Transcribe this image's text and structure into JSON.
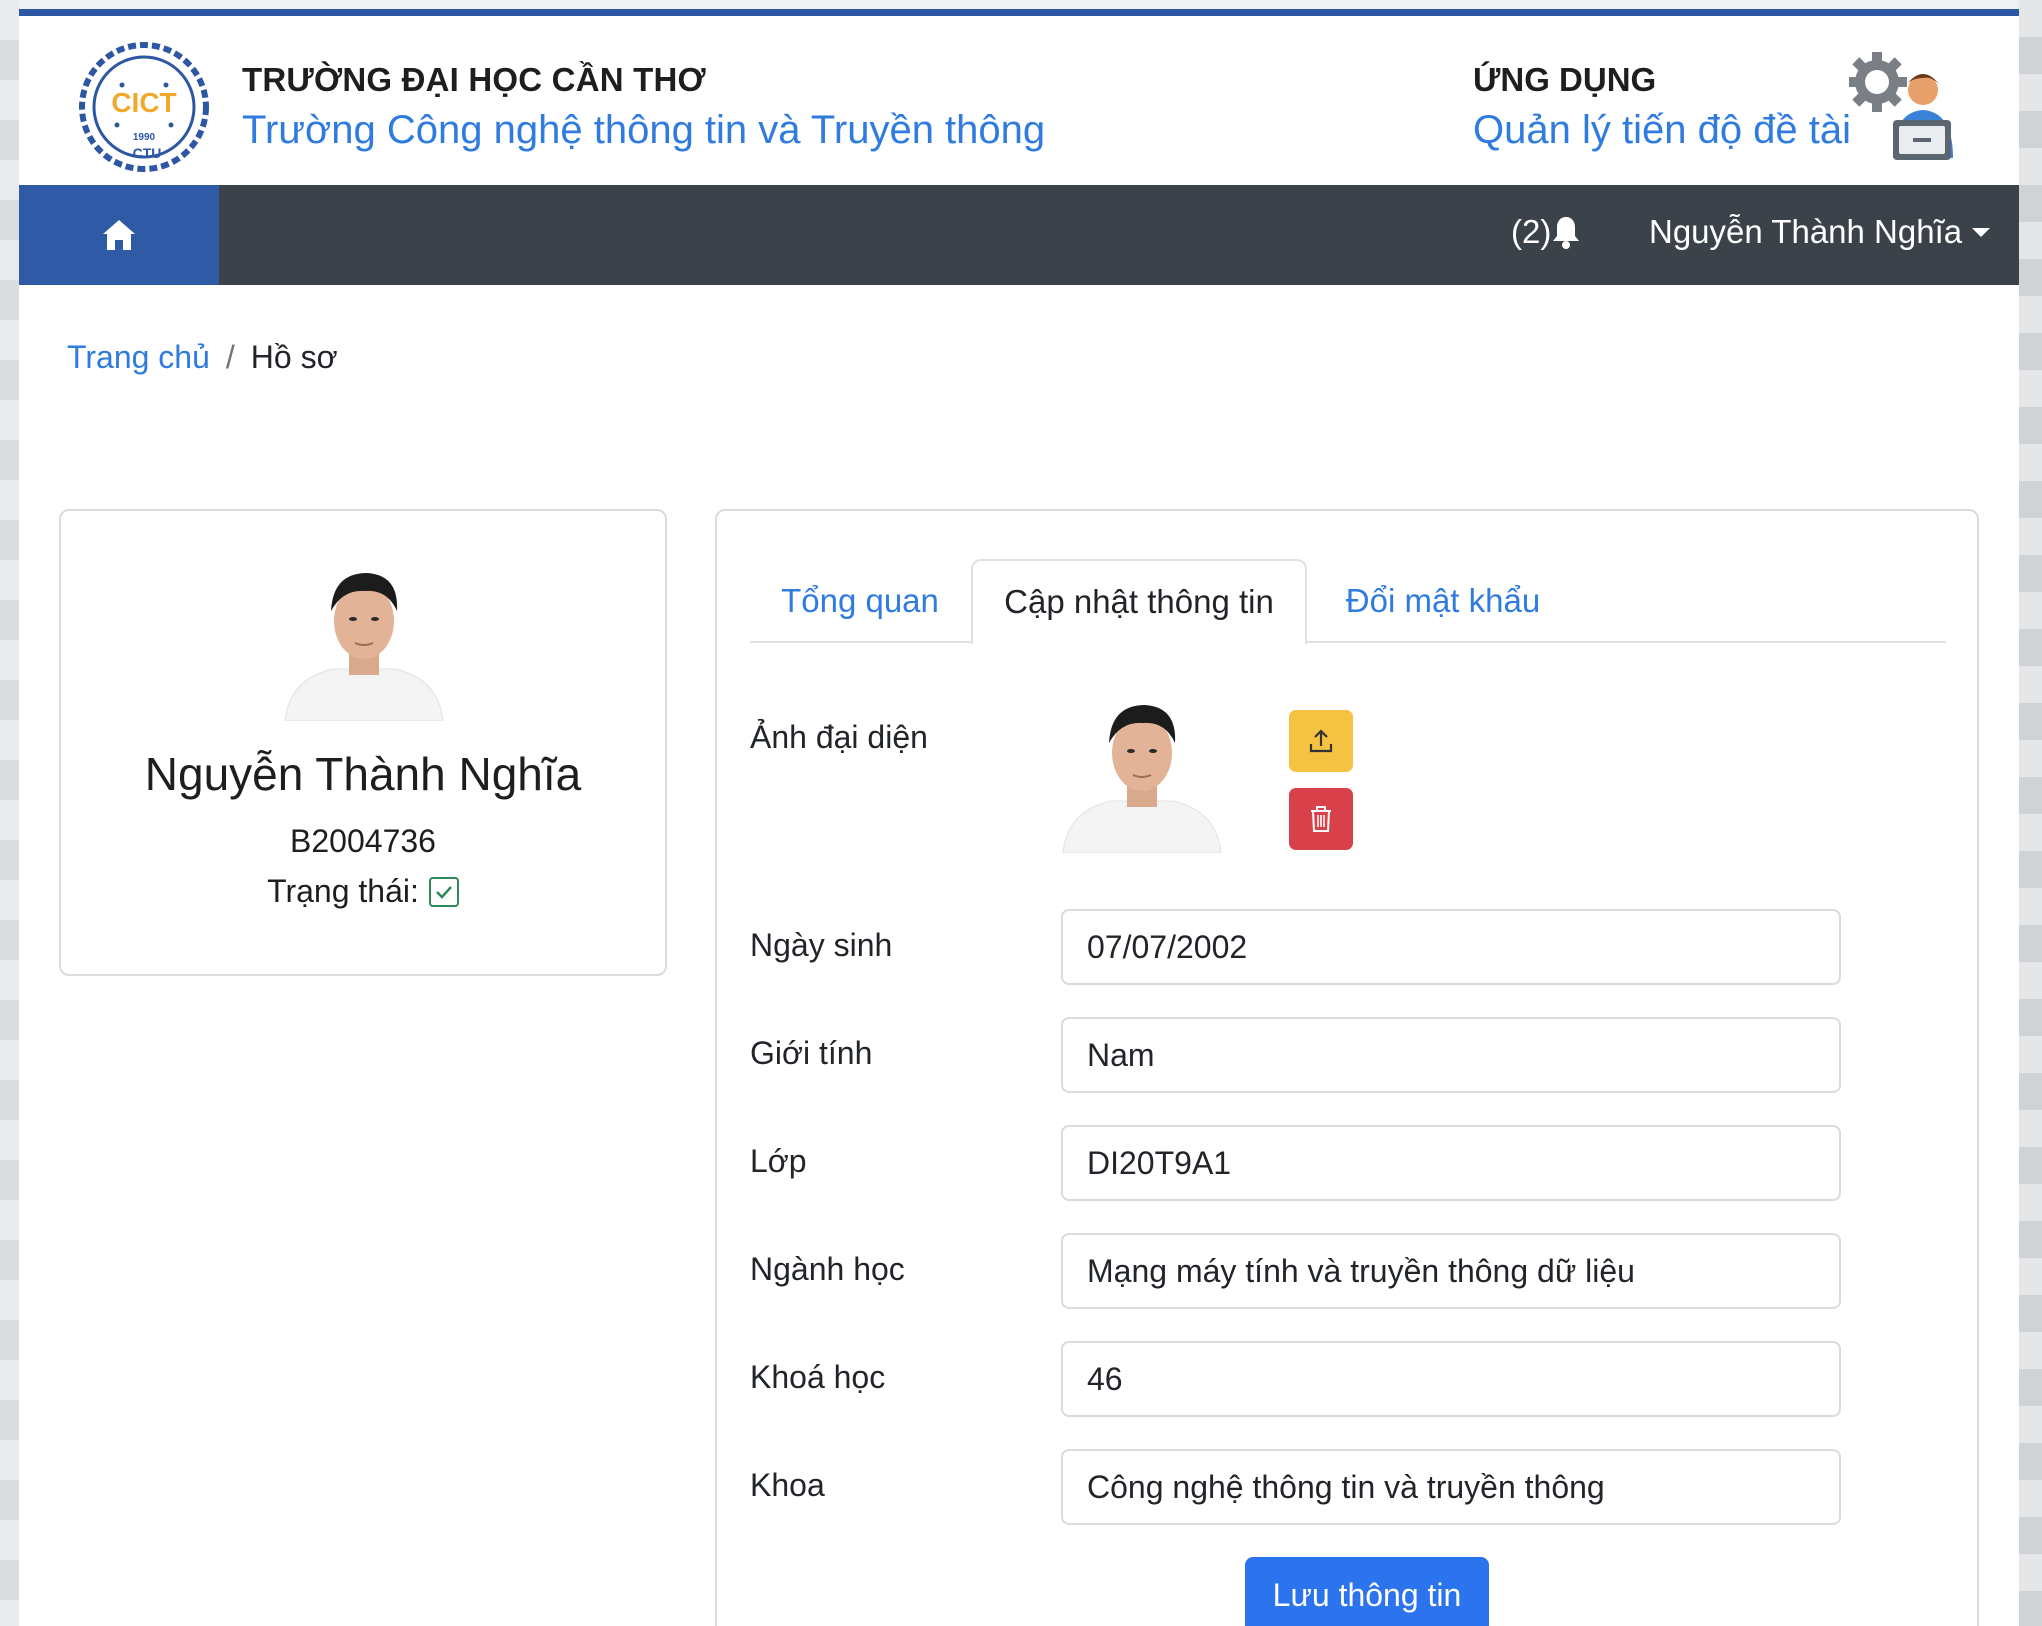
{
  "header": {
    "university": "TRƯỜNG ĐẠI HỌC CẦN THƠ",
    "school": "Trường Công nghệ thông tin và Truyền thông",
    "app_label": "ỨNG DỤNG",
    "app_name": "Quản lý tiến độ đề tài",
    "logo_text": "CICT",
    "logo_year": "1990",
    "logo_abbr": "CTU"
  },
  "nav": {
    "notification_count": "(2)",
    "user_name": "Nguyễn Thành Nghĩa"
  },
  "breadcrumb": {
    "home": "Trang chủ",
    "current": "Hồ sơ"
  },
  "profile": {
    "name": "Nguyễn Thành Nghĩa",
    "student_id": "B2004736",
    "status_label": "Trạng thái:"
  },
  "tabs": [
    {
      "label": "Tổng quan"
    },
    {
      "label": "Cập nhật thông tin"
    },
    {
      "label": "Đổi mật khẩu"
    }
  ],
  "form": {
    "avatar_label": "Ảnh đại diện",
    "fields": [
      {
        "label": "Ngày sinh",
        "value": "07/07/2002"
      },
      {
        "label": "Giới tính",
        "value": "Nam"
      },
      {
        "label": "Lớp",
        "value": "DI20T9A1"
      },
      {
        "label": "Ngành học",
        "value": "Mạng máy tính và truyền thông dữ liệu"
      },
      {
        "label": "Khoá học",
        "value": "46"
      },
      {
        "label": "Khoa",
        "value": "Công nghệ thông tin và truyền thông"
      }
    ],
    "save_label": "Lưu thông tin"
  },
  "colors": {
    "brand_blue": "#2e5aa6",
    "nav_dark": "#3c4249",
    "link_blue": "#2f7be0",
    "upload_yellow": "#f5c242",
    "delete_red": "#d9414a",
    "save_blue": "#2c73ee"
  }
}
